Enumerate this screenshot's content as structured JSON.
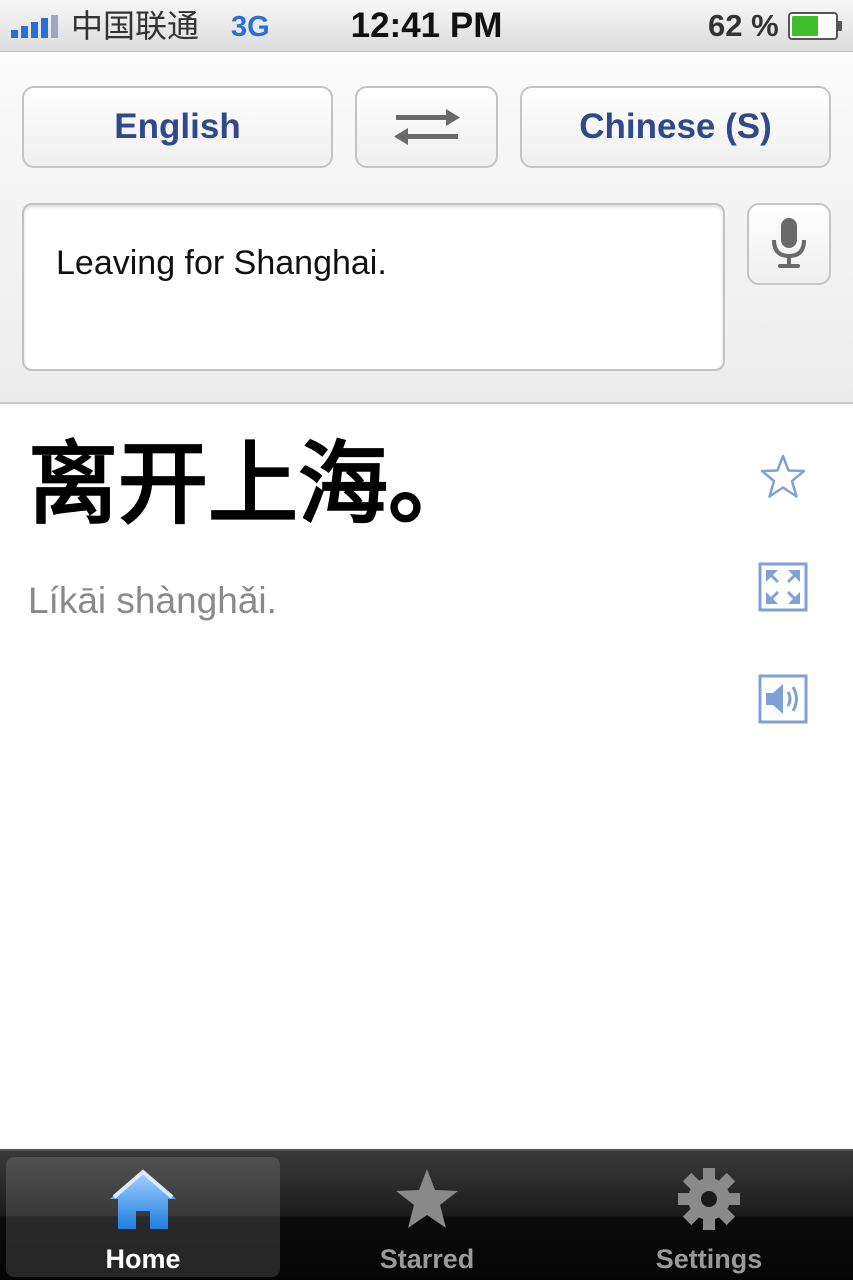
{
  "status_bar": {
    "carrier": "中国联通",
    "network": "3G",
    "time": "12:41 PM",
    "battery_percent": "62 %",
    "battery_level": 0.62,
    "signal_bars": 4
  },
  "language_bar": {
    "source_language": "English",
    "target_language": "Chinese (S)",
    "swap_icon": "swap-arrows-icon"
  },
  "input": {
    "text": "Leaving for Shanghai.",
    "mic_icon": "microphone-icon"
  },
  "result": {
    "translation": "离开上海。",
    "romanization": "Líkāi shànghǎi.",
    "actions": [
      "star-icon",
      "fullscreen-icon",
      "speaker-icon"
    ]
  },
  "tab_bar": {
    "tabs": [
      {
        "label": "Home",
        "icon": "home-icon",
        "active": true
      },
      {
        "label": "Starred",
        "icon": "star-icon",
        "active": false
      },
      {
        "label": "Settings",
        "icon": "gear-icon",
        "active": false
      }
    ]
  },
  "colors": {
    "accent_blue": "#2e4a8a",
    "link_icon_blue": "#7fa2d6",
    "pinyin_gray": "#8a8a8a",
    "tab_bar_dark": "#111111",
    "network_blue": "#2a6fd6",
    "battery_green": "#3fbf2a"
  }
}
